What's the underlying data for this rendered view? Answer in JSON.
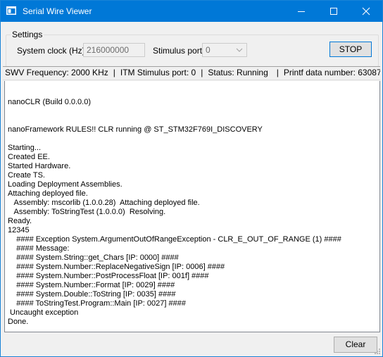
{
  "window": {
    "title": "Serial Wire Viewer",
    "icon": "app-window-icon",
    "controls": [
      "minimize-icon",
      "maximize-icon",
      "close-icon"
    ]
  },
  "settings": {
    "group_label": "Settings",
    "system_clock_label": "System clock (Hz):",
    "system_clock_value": "216000000",
    "stimulus_port_label": "Stimulus port:",
    "stimulus_port_value": "0",
    "stop_button": "STOP"
  },
  "status": {
    "swv_frequency": "SWV Frequency: 2000 KHz",
    "itm_port": "ITM Stimulus port: 0",
    "state": "Status: Running",
    "printf_count": "Printf data number: 63087"
  },
  "output_lines": [
    "",
    "nanoCLR (Build 0.0.0.0)",
    "",
    "",
    "nanoFramework RULES!! CLR running @ ST_STM32F769I_DISCOVERY",
    "",
    "Starting...",
    "Created EE.",
    "Started Hardware.",
    "Create TS.",
    "Loading Deployment Assemblies.",
    "Attaching deployed file.",
    "   Assembly: mscorlib (1.0.0.28)  Attaching deployed file.",
    "   Assembly: ToStringTest (1.0.0.0)  Resolving.",
    "Ready.",
    "12345",
    "    #### Exception System.ArgumentOutOfRangeException - CLR_E_OUT_OF_RANGE (1) ####",
    "    #### Message: ",
    "    #### System.String::get_Chars [IP: 0000] ####",
    "    #### System.Number::ReplaceNegativeSign [IP: 0006] ####",
    "    #### System.Number::PostProcessFloat [IP: 001f] ####",
    "    #### System.Number::Format [IP: 0029] ####",
    "    #### System.Double::ToString [IP: 0035] ####",
    "    #### ToStringTest.Program::Main [IP: 0027] ####",
    " Uncaught exception",
    "Done."
  ],
  "footer": {
    "clear_button": "Clear"
  },
  "colors": {
    "titlebar": "#0078d7",
    "window_bg": "#f0f0f0",
    "button_focus_border": "#0078d7"
  }
}
